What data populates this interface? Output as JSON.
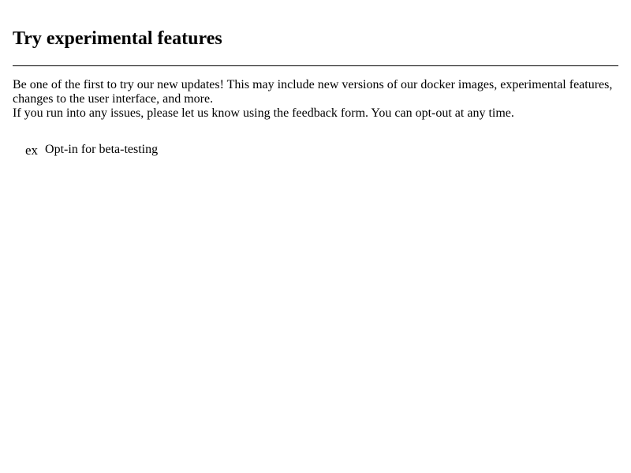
{
  "header": {
    "title": "Try experimental features"
  },
  "description": {
    "line1": "Be one of the first to try our new updates! This may include new versions of our docker images, experimental features, changes to the user interface, and more.",
    "line2": "If you run into any issues, please let us know using the feedback form. You can opt-out at any time."
  },
  "beta_optin": {
    "icon_text": "ex",
    "label": "Opt-in for beta-testing"
  }
}
